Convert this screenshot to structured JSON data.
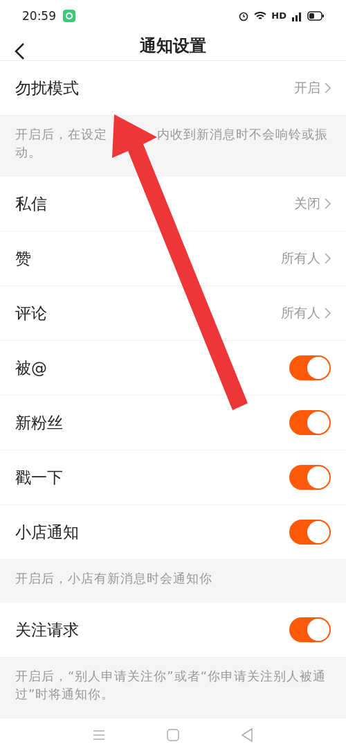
{
  "status_bar": {
    "time": "20:59",
    "network": "HD"
  },
  "header": {
    "title": "通知设置"
  },
  "sections": [
    {
      "rows": [
        {
          "kind": "link",
          "label": "勿扰模式",
          "value": "开启"
        }
      ],
      "note_lines": [
        [
          "开启后，在设定",
          "内收到新消息时不会响铃或振"
        ],
        [
          "动。"
        ]
      ]
    },
    {
      "rows": [
        {
          "kind": "link",
          "label": "私信",
          "value": "关闭"
        },
        {
          "kind": "link",
          "label": "赞",
          "value": "所有人"
        },
        {
          "kind": "link",
          "label": "评论",
          "value": "所有人"
        },
        {
          "kind": "toggle",
          "label": "被@",
          "on": true
        },
        {
          "kind": "toggle",
          "label": "新粉丝",
          "on": true
        },
        {
          "kind": "toggle",
          "label": "戳一下",
          "on": true
        },
        {
          "kind": "toggle",
          "label": "小店通知",
          "on": true
        }
      ],
      "note_lines": [
        [
          "开启后，小店有新消息时会通知你"
        ]
      ]
    },
    {
      "rows": [
        {
          "kind": "toggle",
          "label": "关注请求",
          "on": true
        }
      ],
      "note_lines": [
        [
          "开启后，“别人申请关注你”或者“你申请关注别人被通过”时将通知你。"
        ]
      ]
    }
  ]
}
